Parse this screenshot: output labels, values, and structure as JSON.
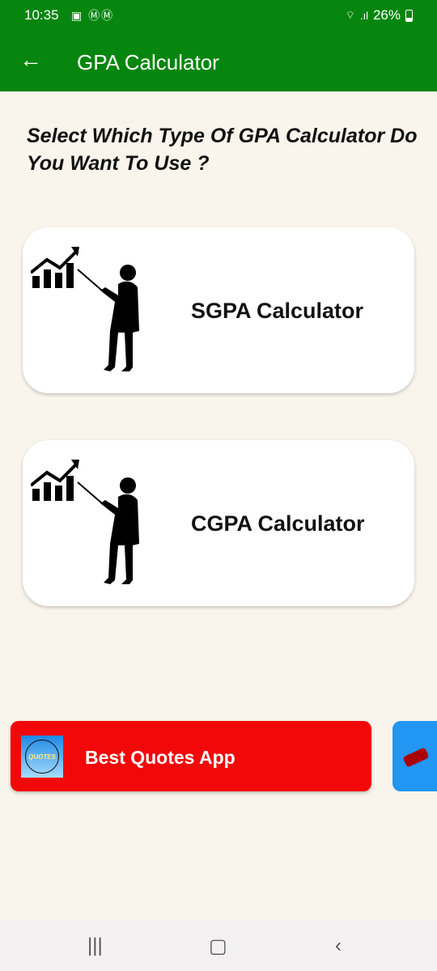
{
  "status_bar": {
    "time": "10:35",
    "notification_icons": [
      "gallery-icon",
      "gmail-icon",
      "gmail-icon"
    ],
    "battery": "26%"
  },
  "app_bar": {
    "title": "GPA Calculator",
    "back_icon": "arrow-left-icon"
  },
  "question": "Select Which Type Of GPA Calculator Do You Want To Use ?",
  "options": [
    {
      "label": "SGPA Calculator",
      "icon": "presenter-chart-icon"
    },
    {
      "label": "CGPA Calculator",
      "icon": "presenter-chart-icon"
    }
  ],
  "promo": {
    "label": "Best Quotes App",
    "icon_text": "QUOTES",
    "color": "#f20808",
    "next_color": "#2196f3"
  },
  "colors": {
    "primary": "#06860e",
    "background": "#f9f5ec"
  }
}
